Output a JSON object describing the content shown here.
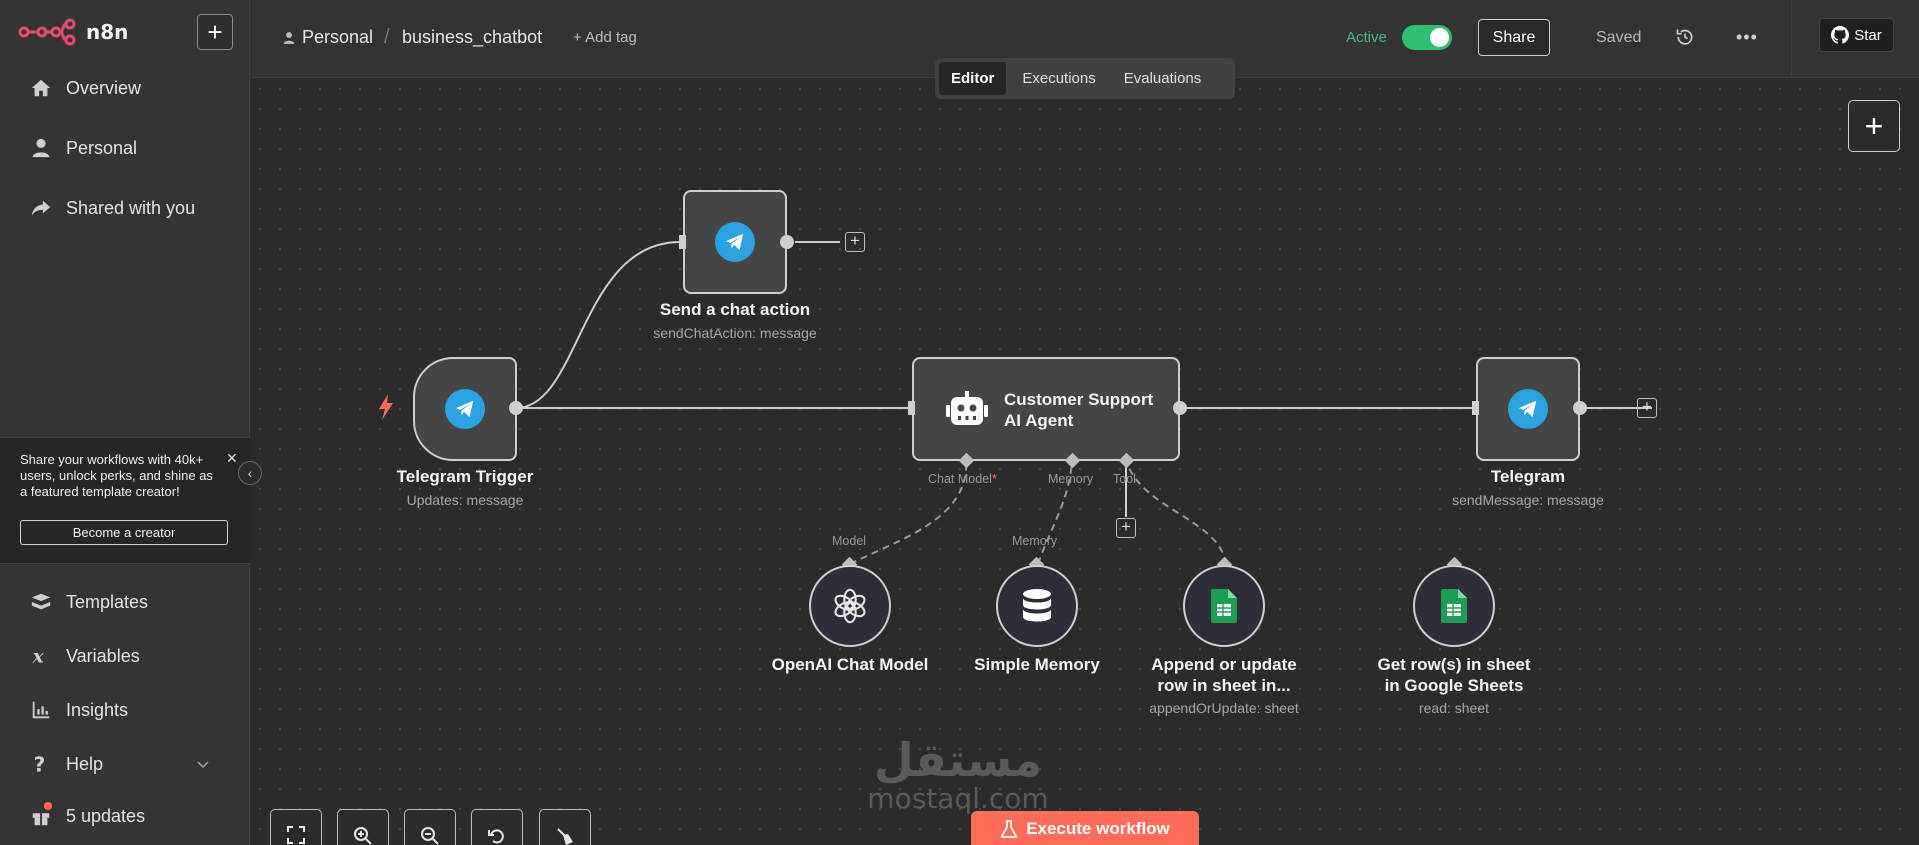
{
  "app": {
    "name": "n8n"
  },
  "sidebar": {
    "nav": [
      {
        "label": "Overview",
        "icon": "home-icon"
      },
      {
        "label": "Personal",
        "icon": "user-icon"
      },
      {
        "label": "Shared with you",
        "icon": "share-icon"
      }
    ],
    "promo": {
      "text": "Share your workflows with 40k+ users, unlock perks, and shine as a featured template creator!",
      "button": "Become a creator"
    },
    "bottom_nav": [
      {
        "label": "Templates",
        "icon": "templates-icon"
      },
      {
        "label": "Variables",
        "icon": "variables-icon"
      },
      {
        "label": "Insights",
        "icon": "insights-icon"
      },
      {
        "label": "Help",
        "icon": "help-icon"
      },
      {
        "label": "5 updates",
        "icon": "gift-icon"
      }
    ]
  },
  "header": {
    "project": "Personal",
    "workflow_name": "business_chatbot",
    "add_tag": "+ Add tag",
    "active_label": "Active",
    "active": true,
    "share": "Share",
    "saved": "Saved",
    "star": "Star"
  },
  "tabs": [
    {
      "label": "Editor",
      "active": true
    },
    {
      "label": "Executions",
      "active": false
    },
    {
      "label": "Evaluations",
      "active": false
    }
  ],
  "nodes": {
    "send_chat_action": {
      "title": "Send a chat action",
      "subtitle": "sendChatAction: message"
    },
    "telegram_trigger": {
      "title": "Telegram Trigger",
      "subtitle": "Updates: message"
    },
    "agent": {
      "title_line1": "Customer Support",
      "title_line2": "AI Agent",
      "inputs": [
        "Chat Model",
        "Memory",
        "Tool"
      ],
      "required_marker": "*"
    },
    "telegram": {
      "title": "Telegram",
      "subtitle": "sendMessage: message"
    },
    "openai": {
      "title": "OpenAI Chat Model",
      "port_label": "Model"
    },
    "memory": {
      "title": "Simple Memory",
      "port_label": "Memory"
    },
    "sheets_append": {
      "title_line1": "Append or update",
      "title_line2": "row in sheet in...",
      "subtitle": "appendOrUpdate: sheet"
    },
    "sheets_get": {
      "title_line1": "Get row(s) in sheet",
      "title_line2": "in Google Sheets",
      "subtitle": "read: sheet"
    }
  },
  "canvas": {
    "execute_button": "Execute workflow"
  },
  "watermark": {
    "arabic": "مستقل",
    "latin": "mostaql.com"
  },
  "colors": {
    "accent": "#ff6d5a",
    "active_green": "#2fbf71",
    "telegram_blue": "#2aa3e0",
    "sheets_green": "#1e9e55"
  }
}
